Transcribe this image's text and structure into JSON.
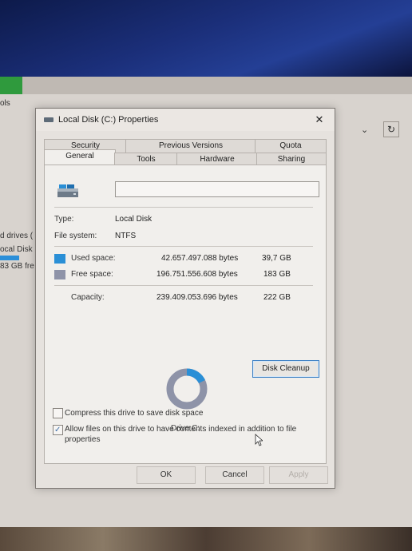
{
  "background": {
    "explorer_tools_label": "ols",
    "left_items": [
      "d drives (",
      "ocal Disk"
    ],
    "left_free": "83 GB fre",
    "accent": "#2b8fd9"
  },
  "dialog": {
    "title": "Local Disk (C:) Properties",
    "close_glyph": "✕",
    "tabs_top": [
      "Security",
      "Previous Versions",
      "Quota"
    ],
    "tabs_bottom": [
      "General",
      "Tools",
      "Hardware",
      "Sharing"
    ],
    "active_tab": "General",
    "label_value": "",
    "type_label": "Type:",
    "type_value": "Local Disk",
    "fs_label": "File system:",
    "fs_value": "NTFS",
    "used": {
      "label": "Used space:",
      "bytes": "42.657.497.088 bytes",
      "size": "39,7 GB",
      "color": "#2a8fd6"
    },
    "free": {
      "label": "Free space:",
      "bytes": "196.751.556.608 bytes",
      "size": "183 GB",
      "color": "#8e93a8"
    },
    "capacity": {
      "label": "Capacity:",
      "bytes": "239.409.053.696 bytes",
      "size": "222 GB"
    },
    "used_fraction": 0.178,
    "drive_label": "Drive C:",
    "cleanup_button": "Disk Cleanup",
    "compress_text": "Compress this drive to save disk space",
    "compress_checked": false,
    "index_text": "Allow files on this drive to have contents indexed in addition to file properties",
    "index_checked": true,
    "ok_button": "OK",
    "cancel_button": "Cancel",
    "apply_button": "Apply"
  }
}
